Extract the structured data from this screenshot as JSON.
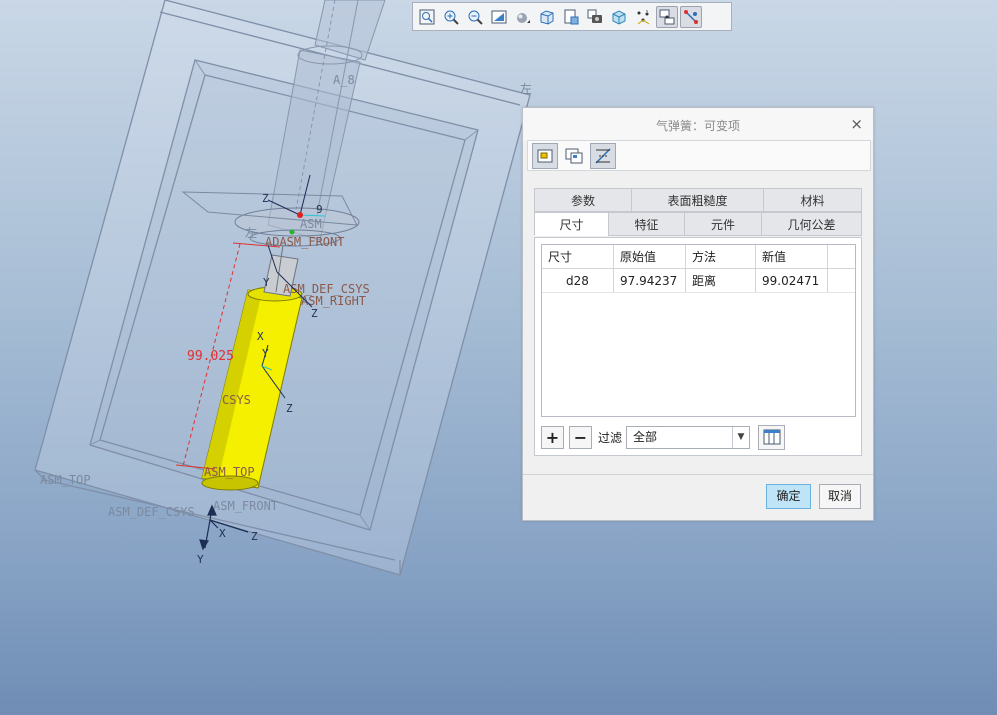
{
  "viewport": {
    "labels": {
      "a8": "A_8",
      "left_top": "左",
      "left_mid": "左",
      "ad_asm_front": "ADASM_FRONT",
      "asm_def_csys_upper": "ASM_DEF_CSYS",
      "asm_right": "ASM_RIGHT",
      "csys": "CSYS",
      "asm_top_inner": "ASM_TOP",
      "asm_top_outer": "ASM_TOP",
      "asm_def_csys_lower": "ASM_DEF_CSYS",
      "asm_front_lower": "ASM_FRONT",
      "dimension": "99.025",
      "a9": "9",
      "asm_tag": "ASM",
      "axis_z": "Z",
      "axis_y": "Y",
      "axis_x": "X"
    }
  },
  "toolbar": {
    "buttons": [
      "zoom-fit-icon",
      "zoom-in-icon",
      "zoom-out-icon",
      "repaint-icon",
      "display-style-icon",
      "saved-orientation-icon",
      "view-manager-icon",
      "appearance-icon",
      "named-view-icon",
      "datum-display-icon",
      "spin-center-icon",
      "annotation-display-icon"
    ]
  },
  "dialog": {
    "title": "气弹簧：可变项",
    "close": "×",
    "tabs_row1": [
      "参数",
      "表面粗糙度",
      "材料"
    ],
    "tabs_row2": [
      "尺寸",
      "特征",
      "元件",
      "几何公差"
    ],
    "selected_tab": "尺寸",
    "table": {
      "headers": [
        "尺寸",
        "原始值",
        "方法",
        "新值",
        ""
      ],
      "rows": [
        [
          "d28",
          "97.94237",
          "距离",
          "99.02471",
          ""
        ]
      ]
    },
    "add": "+",
    "remove": "−",
    "filter_label": "过滤",
    "filter_value": "全部",
    "ok": "确定",
    "cancel": "取消"
  },
  "colors": {
    "part_yellow": "#f4f000",
    "dimension_red": "#e03030",
    "ok_button": "#bfe3f7"
  }
}
